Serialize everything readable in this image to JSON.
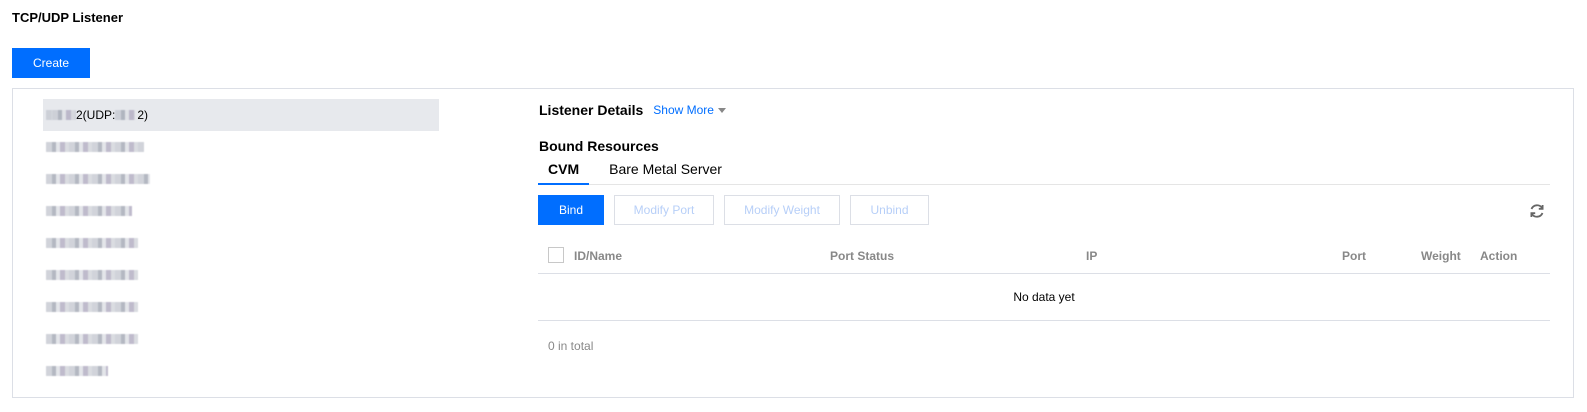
{
  "page": {
    "title": "TCP/UDP Listener"
  },
  "toolbar": {
    "create_label": "Create"
  },
  "listeners": [
    {
      "suffix": "2(UDP:",
      "suffix2": "2)",
      "selected": true
    },
    {
      "suffix": "",
      "suffix2": ""
    },
    {
      "suffix": "",
      "suffix2": ""
    },
    {
      "suffix": "",
      "suffix2": ""
    },
    {
      "suffix": "",
      "suffix2": ""
    },
    {
      "suffix": "",
      "suffix2": ""
    },
    {
      "suffix": "",
      "suffix2": ""
    },
    {
      "suffix": "",
      "suffix2": ""
    },
    {
      "suffix": "",
      "suffix2": ""
    }
  ],
  "details": {
    "title": "Listener Details",
    "show_more": "Show More",
    "bound_title": "Bound Resources",
    "tabs": [
      "CVM",
      "Bare Metal Server"
    ],
    "active_tab": "CVM",
    "buttons": {
      "bind": "Bind",
      "modify_port": "Modify Port",
      "modify_weight": "Modify Weight",
      "unbind": "Unbind"
    },
    "columns": [
      "ID/Name",
      "Port Status",
      "IP",
      "Port",
      "Weight",
      "Action"
    ],
    "empty_text": "No data yet",
    "total_text": "0 in total"
  },
  "icons": {
    "refresh": "refresh-icon",
    "caret": "caret-down-icon"
  },
  "colors": {
    "accent": "#006eff",
    "selected_row": "#e7e9ed",
    "disabled_text": "#b7cff8"
  }
}
